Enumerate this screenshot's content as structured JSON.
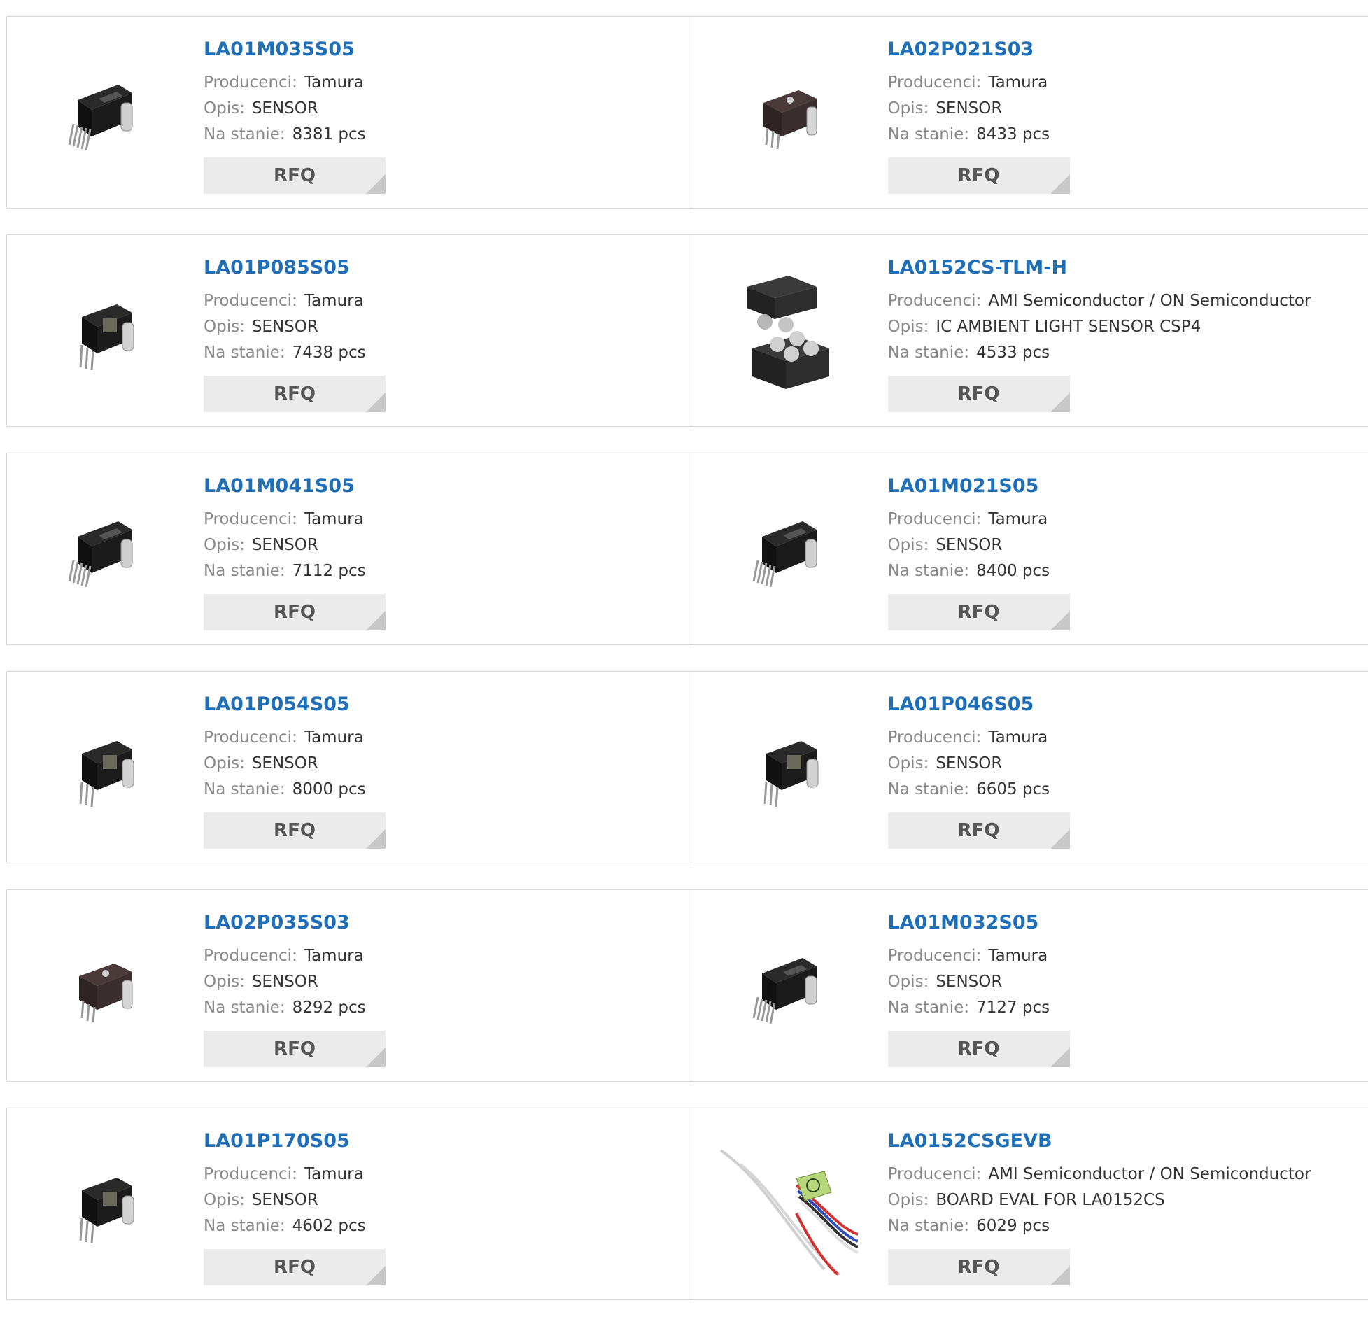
{
  "labels": {
    "manufacturer": "Producenci:",
    "description": "Opis:",
    "stock": "Na stanie:",
    "rfq": "RFQ"
  },
  "products": [
    {
      "part": "LA01M035S05",
      "manufacturer": "Tamura",
      "description": "SENSOR",
      "stock": "8381 pcs",
      "image": "tamura-sensor-5pin-icon"
    },
    {
      "part": "LA02P021S03",
      "manufacturer": "Tamura",
      "description": "SENSOR",
      "stock": "8433 pcs",
      "image": "tamura-sensor-3pin-brown-icon"
    },
    {
      "part": "LA01P085S05",
      "manufacturer": "Tamura",
      "description": "SENSOR",
      "stock": "7438 pcs",
      "image": "tamura-sensor-3pin-icon"
    },
    {
      "part": "LA0152CS-TLM-H",
      "manufacturer": "AMI Semiconductor / ON Semiconductor",
      "description": "IC AMBIENT LIGHT SENSOR CSP4",
      "stock": "4533 pcs",
      "image": "csp4-chip-icon"
    },
    {
      "part": "LA01M041S05",
      "manufacturer": "Tamura",
      "description": "SENSOR",
      "stock": "7112 pcs",
      "image": "tamura-sensor-5pin-icon"
    },
    {
      "part": "LA01M021S05",
      "manufacturer": "Tamura",
      "description": "SENSOR",
      "stock": "8400 pcs",
      "image": "tamura-sensor-5pin-icon"
    },
    {
      "part": "LA01P054S05",
      "manufacturer": "Tamura",
      "description": "SENSOR",
      "stock": "8000 pcs",
      "image": "tamura-sensor-3pin-icon"
    },
    {
      "part": "LA01P046S05",
      "manufacturer": "Tamura",
      "description": "SENSOR",
      "stock": "6605 pcs",
      "image": "tamura-sensor-3pin-icon"
    },
    {
      "part": "LA02P035S03",
      "manufacturer": "Tamura",
      "description": "SENSOR",
      "stock": "8292 pcs",
      "image": "tamura-sensor-3pin-brown-icon"
    },
    {
      "part": "LA01M032S05",
      "manufacturer": "Tamura",
      "description": "SENSOR",
      "stock": "7127 pcs",
      "image": "tamura-sensor-5pin-icon"
    },
    {
      "part": "LA01P170S05",
      "manufacturer": "Tamura",
      "description": "SENSOR",
      "stock": "4602 pcs",
      "image": "tamura-sensor-3pin-icon"
    },
    {
      "part": "LA0152CSGEVB",
      "manufacturer": "AMI Semiconductor / ON Semiconductor",
      "description": "BOARD EVAL FOR LA0152CS",
      "stock": "6029 pcs",
      "image": "eval-board-wires-icon"
    }
  ],
  "colors": {
    "link": "#1f6fb8",
    "label": "#888888",
    "value": "#333333",
    "rfq_bg": "#ebebeb",
    "border": "#d4d4d4"
  }
}
